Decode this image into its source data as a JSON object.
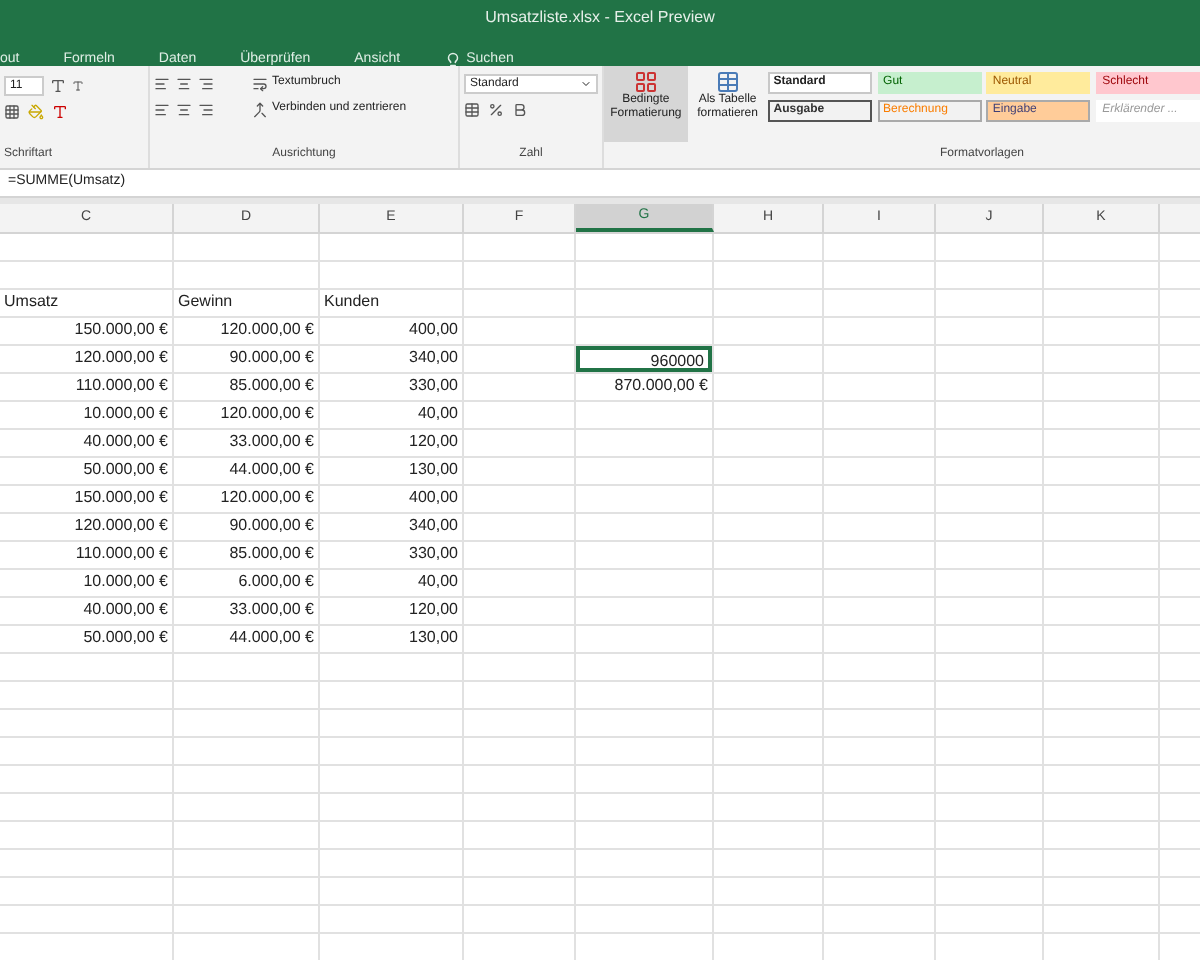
{
  "window": {
    "title": "Umsatzliste.xlsx  -  Excel Preview"
  },
  "menu_tabs": [
    {
      "label": "out",
      "selected": false
    },
    {
      "label": "Formeln",
      "selected": false
    },
    {
      "label": "Daten",
      "selected": false
    },
    {
      "label": "Überprüfen",
      "selected": false
    },
    {
      "label": "Ansicht",
      "selected": false
    }
  ],
  "tell_me": {
    "placeholder": "Suchen"
  },
  "ribbon": {
    "font_size": "11",
    "wrap_text": "Textumbruch",
    "merge_center": "Verbinden und zentrieren",
    "number_format": "Standard",
    "conditional_formatting": "Bedingte Formatierung",
    "format_as_table": "Als Tabelle formatieren",
    "groups": [
      "Schriftart",
      "Ausrichtung",
      "Zahl",
      "Formatvorlagen"
    ],
    "styles": [
      {
        "label": "Standard",
        "kind": "standard"
      },
      {
        "label": "Gut",
        "kind": "good"
      },
      {
        "label": "Neutral",
        "kind": "neutral"
      },
      {
        "label": "Schlecht",
        "kind": "bad"
      },
      {
        "label": "Ausgabe",
        "kind": "output"
      },
      {
        "label": "Berechnung",
        "kind": "calc"
      },
      {
        "label": "Eingabe",
        "kind": "input"
      },
      {
        "label": "Erklärender ...",
        "kind": "note"
      }
    ]
  },
  "formula_bar": {
    "value": "=SUMME(Umsatz)"
  },
  "columns": [
    {
      "label": "C",
      "selected": false
    },
    {
      "label": "D",
      "selected": false
    },
    {
      "label": "E",
      "selected": false
    },
    {
      "label": "F",
      "selected": false
    },
    {
      "label": "G",
      "selected": true
    },
    {
      "label": "H",
      "selected": false
    },
    {
      "label": "I",
      "selected": false
    },
    {
      "label": "J",
      "selected": false
    },
    {
      "label": "K",
      "selected": false
    }
  ],
  "rows": [
    {
      "cells": {
        "C": {
          "text": "Umsatz",
          "kind": "text",
          "selected": false
        },
        "D": {
          "text": "Gewinn",
          "kind": "text",
          "selected": false
        },
        "E": {
          "text": "Kunden",
          "kind": "text",
          "selected": false
        }
      }
    },
    {
      "cells": {
        "C": {
          "text": "150.000,00 €",
          "kind": "number",
          "selected": false
        },
        "D": {
          "text": "120.000,00 €",
          "kind": "number",
          "selected": false
        },
        "E": {
          "text": "400,00",
          "kind": "number",
          "selected": false
        }
      }
    },
    {
      "cells": {
        "C": {
          "text": "120.000,00 €",
          "kind": "number",
          "selected": false
        },
        "D": {
          "text": "90.000,00 €",
          "kind": "number",
          "selected": false
        },
        "E": {
          "text": "340,00",
          "kind": "number",
          "selected": false
        },
        "G": {
          "text": "960000",
          "kind": "number",
          "selected": true
        }
      }
    },
    {
      "cells": {
        "C": {
          "text": "110.000,00 €",
          "kind": "number",
          "selected": false
        },
        "D": {
          "text": "85.000,00 €",
          "kind": "number",
          "selected": false
        },
        "E": {
          "text": "330,00",
          "kind": "number",
          "selected": false
        },
        "G": {
          "text": "870.000,00 €",
          "kind": "number",
          "selected": false
        }
      }
    },
    {
      "cells": {
        "C": {
          "text": "10.000,00 €",
          "kind": "number",
          "selected": false
        },
        "D": {
          "text": "120.000,00 €",
          "kind": "number",
          "selected": false
        },
        "E": {
          "text": "40,00",
          "kind": "number",
          "selected": false
        }
      }
    },
    {
      "cells": {
        "C": {
          "text": "40.000,00 €",
          "kind": "number",
          "selected": false
        },
        "D": {
          "text": "33.000,00 €",
          "kind": "number",
          "selected": false
        },
        "E": {
          "text": "120,00",
          "kind": "number",
          "selected": false
        }
      }
    },
    {
      "cells": {
        "C": {
          "text": "50.000,00 €",
          "kind": "number",
          "selected": false
        },
        "D": {
          "text": "44.000,00 €",
          "kind": "number",
          "selected": false
        },
        "E": {
          "text": "130,00",
          "kind": "number",
          "selected": false
        }
      }
    },
    {
      "cells": {
        "C": {
          "text": "150.000,00 €",
          "kind": "number",
          "selected": false
        },
        "D": {
          "text": "120.000,00 €",
          "kind": "number",
          "selected": false
        },
        "E": {
          "text": "400,00",
          "kind": "number",
          "selected": false
        }
      }
    },
    {
      "cells": {
        "C": {
          "text": "120.000,00 €",
          "kind": "number",
          "selected": false
        },
        "D": {
          "text": "90.000,00 €",
          "kind": "number",
          "selected": false
        },
        "E": {
          "text": "340,00",
          "kind": "number",
          "selected": false
        }
      }
    },
    {
      "cells": {
        "C": {
          "text": "110.000,00 €",
          "kind": "number",
          "selected": false
        },
        "D": {
          "text": "85.000,00 €",
          "kind": "number",
          "selected": false
        },
        "E": {
          "text": "330,00",
          "kind": "number",
          "selected": false
        }
      }
    },
    {
      "cells": {
        "C": {
          "text": "10.000,00 €",
          "kind": "number",
          "selected": false
        },
        "D": {
          "text": "6.000,00 €",
          "kind": "number",
          "selected": false
        },
        "E": {
          "text": "40,00",
          "kind": "number",
          "selected": false
        }
      }
    },
    {
      "cells": {
        "C": {
          "text": "40.000,00 €",
          "kind": "number",
          "selected": false
        },
        "D": {
          "text": "33.000,00 €",
          "kind": "number",
          "selected": false
        },
        "E": {
          "text": "120,00",
          "kind": "number",
          "selected": false
        }
      }
    },
    {
      "cells": {
        "C": {
          "text": "50.000,00 €",
          "kind": "number",
          "selected": false
        },
        "D": {
          "text": "44.000,00 €",
          "kind": "number",
          "selected": false
        },
        "E": {
          "text": "130,00",
          "kind": "number",
          "selected": false
        }
      }
    }
  ]
}
